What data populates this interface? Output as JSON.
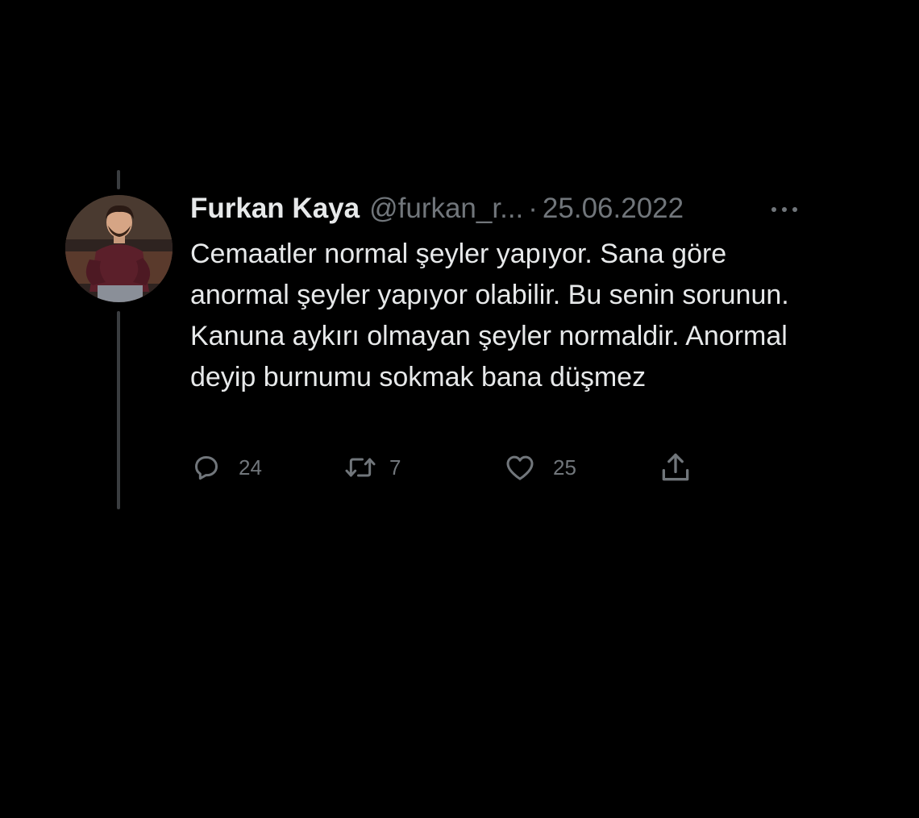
{
  "tweet": {
    "author_name": "Furkan Kaya",
    "handle": "@furkan_r...",
    "separator": "·",
    "date": "25.06.2022",
    "more_icon": "more-icon",
    "text": "Cemaatler normal şeyler yapıyor. Sana göre anormal şeyler yapıyor olabilir. Bu senin sorunun. Kanuna aykırı olmayan şeyler normaldir. Anormal deyip burnumu sokmak bana düşmez",
    "actions": {
      "reply": {
        "icon": "reply-icon",
        "count": "24"
      },
      "retweet": {
        "icon": "retweet-icon",
        "count": "7"
      },
      "like": {
        "icon": "heart-icon",
        "count": "25"
      },
      "share": {
        "icon": "share-icon"
      }
    }
  },
  "colors": {
    "background": "#000000",
    "primary_text": "#e7e9ea",
    "secondary_text": "#71767b",
    "thread_line": "#3a3d40"
  }
}
